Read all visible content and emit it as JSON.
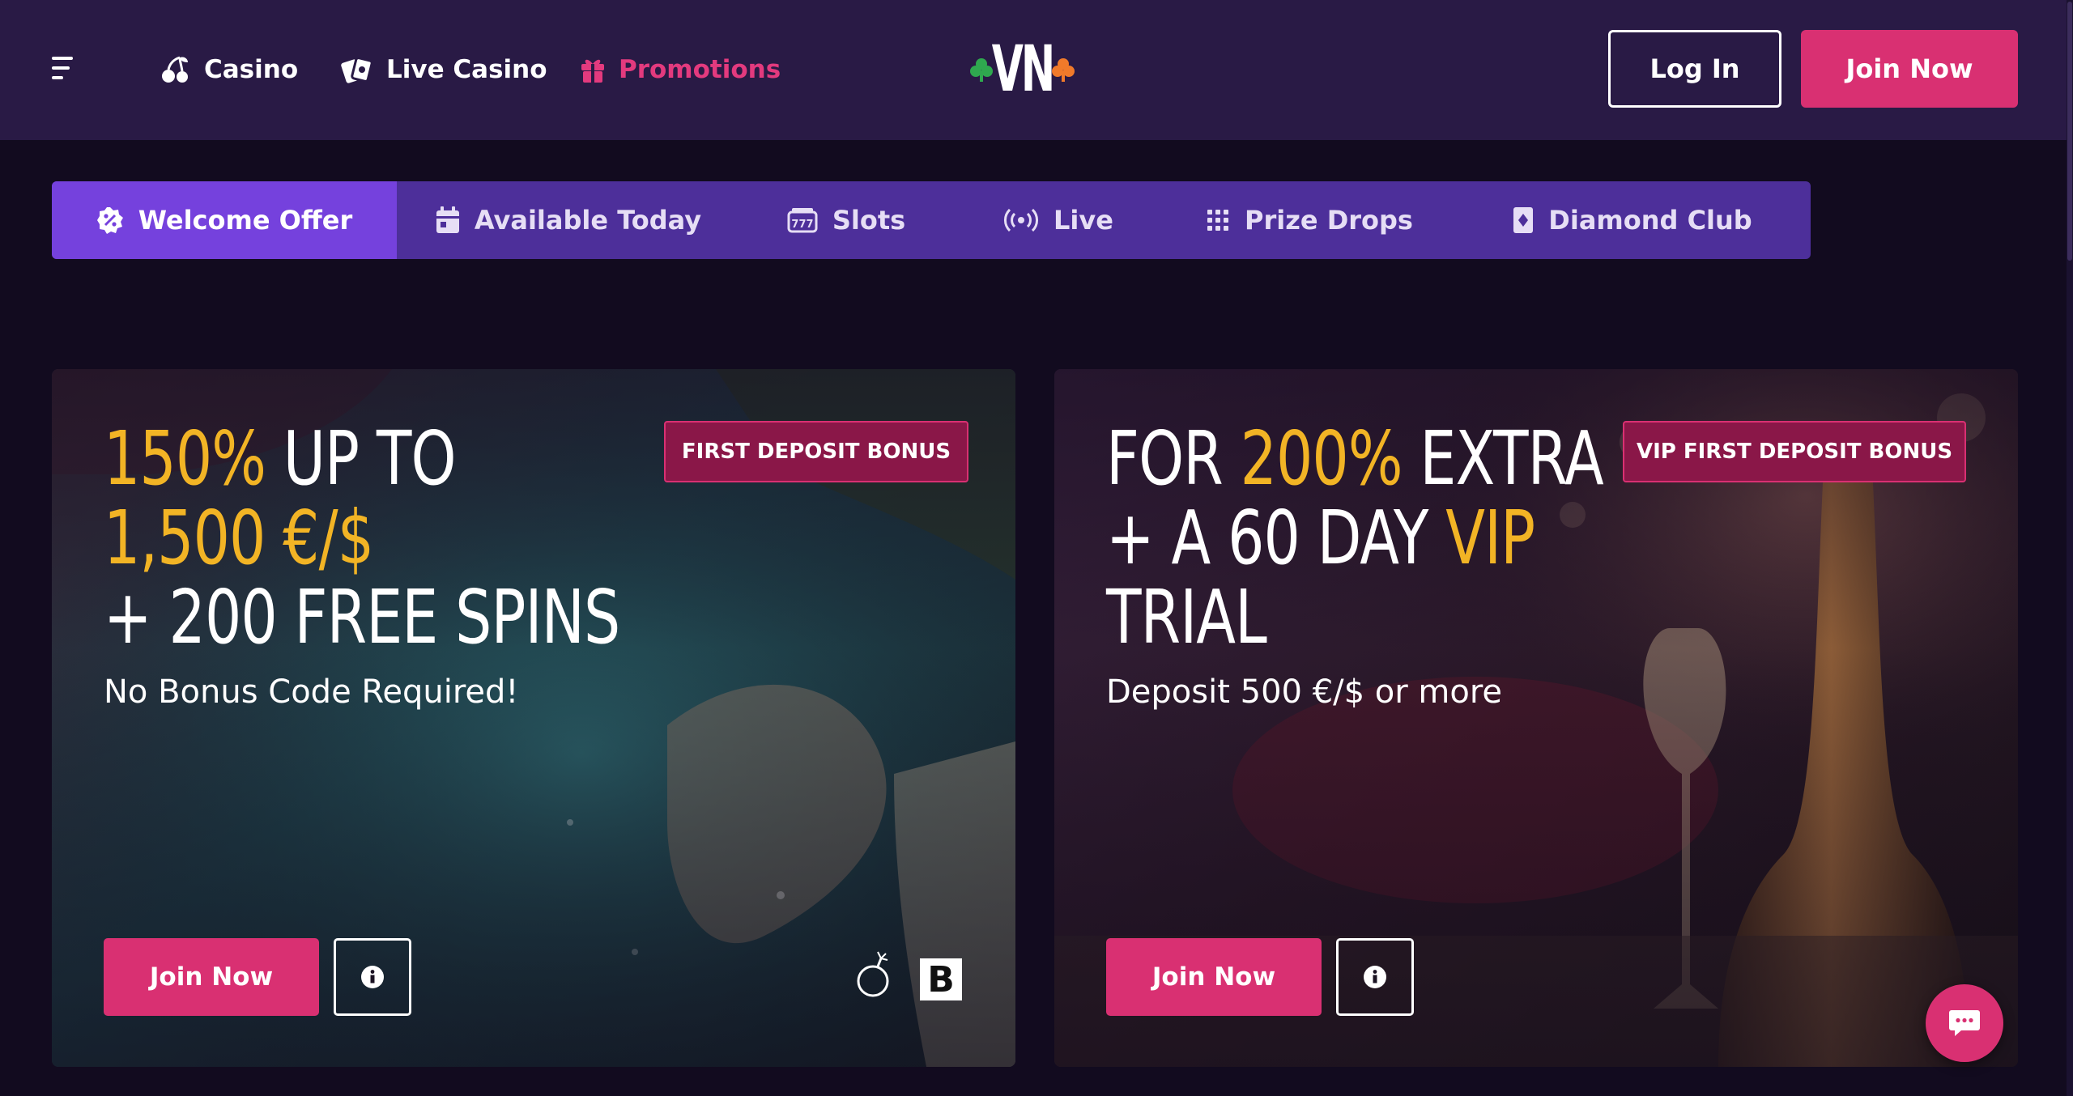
{
  "header": {
    "menu_icon": "hamburger-icon",
    "nav": [
      {
        "label": "Casino",
        "icon": "cherries-icon"
      },
      {
        "label": "Live Casino",
        "icon": "cards-icon"
      },
      {
        "label": "Promotions",
        "icon": "gift-icon",
        "active": true
      }
    ],
    "logo_text": "VN",
    "login_label": "Log In",
    "join_label": "Join Now"
  },
  "tabs": [
    {
      "label": "Welcome Offer",
      "icon": "percent-badge-icon",
      "active": true
    },
    {
      "label": "Available Today",
      "icon": "calendar-icon"
    },
    {
      "label": "Slots",
      "icon": "slot-machine-icon"
    },
    {
      "label": "Live",
      "icon": "broadcast-icon"
    },
    {
      "label": "Prize Drops",
      "icon": "grid-dots-icon"
    },
    {
      "label": "Diamond Club",
      "icon": "diamond-card-icon"
    }
  ],
  "cards": [
    {
      "headline_parts": [
        "150%",
        " UP TO ",
        "1,500 €/$",
        "+ 200 FREE SPINS"
      ],
      "subline": "No Bonus Code Required!",
      "badge": "FIRST DEPOSIT BONUS",
      "join_label": "Join Now",
      "provider_letter": "B"
    },
    {
      "headline_parts": [
        "FOR ",
        "200%",
        " EXTRA",
        "+ A 60 DAY ",
        "VIP",
        "TRIAL"
      ],
      "subline": "Deposit 500 €/$ or more",
      "badge": "VIP FIRST DEPOSIT BONUS",
      "join_label": "Join Now"
    }
  ],
  "colors": {
    "header_bg": "#291a45",
    "page_bg": "#120b1f",
    "accent_pink": "#d93072",
    "tab_bar": "#4d2f9a",
    "tab_active": "#7541dd",
    "gold": "#f2b425",
    "logo_green": "#2fa84f",
    "logo_orange": "#f07a2a"
  }
}
